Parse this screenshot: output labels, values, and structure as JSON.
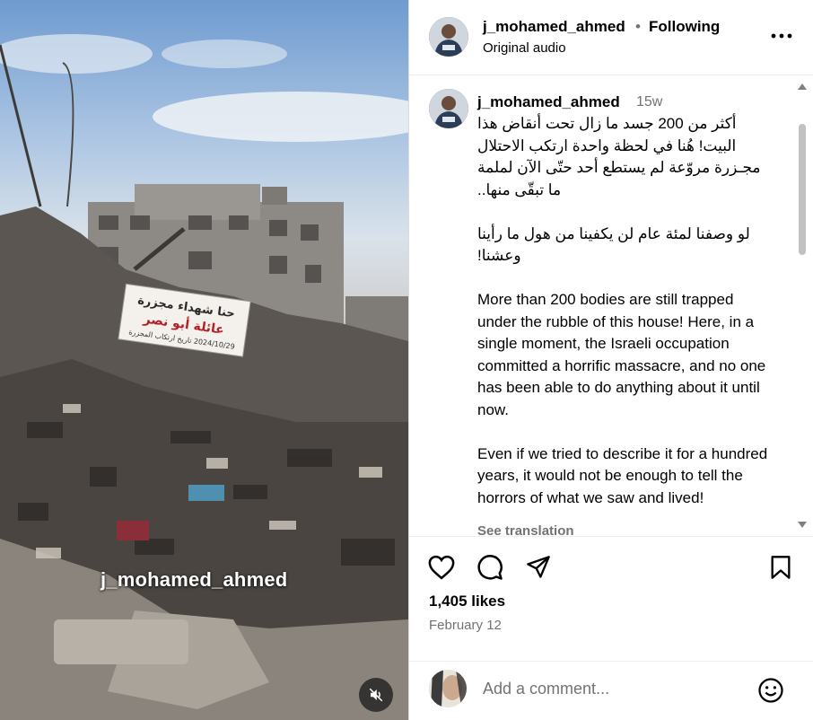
{
  "post": {
    "username": "j_mohamed_ahmed",
    "separator_dot": "•",
    "follow_status": "Following",
    "audio": "Original audio"
  },
  "media": {
    "watermark": "j_mohamed_ahmed",
    "banner_lines": [
      "حنا شهداء مجزرة",
      "عائلة أبو نصر",
      "2024/10/29 تاريخ ارتكاب المجزرة"
    ],
    "mute_icon": "speaker-muted-icon"
  },
  "caption": {
    "username": "j_mohamed_ahmed",
    "time_ago": "15w",
    "arabic_p1": "أكثر من 200 جسد ما زال تحت أنقاض هذا البيت! هُنا في لحظة واحدة ارتكب الاحتلال مجـزرة مروّعة لم يستطع أحد حتّى الآن لملمة ما تبقّى منها..",
    "arabic_p2": "لو وصفنا لمئة عام لن يكفينا من هول ما رأينا وعشنا!",
    "english_p1": "More than 200 bodies are still trapped under the rubble of this house! Here, in a single moment, the Israeli occupation committed a horrific massacre, and no one has been able to do anything about it until now.",
    "english_p2": "Even if we tried to describe it for a hundred years, it would not be enough to tell the horrors of what we saw and lived!",
    "see_translation": "See translation"
  },
  "actions": {
    "like_icon": "heart-icon",
    "comment_icon": "comment-icon",
    "share_icon": "send-icon",
    "save_icon": "bookmark-icon",
    "likes": "1,405 likes",
    "date": "February 12"
  },
  "comment_box": {
    "placeholder": "Add a comment...",
    "emoji_icon": "emoji-icon"
  },
  "colors": {
    "primary_text": "#000000",
    "secondary_text": "#737373",
    "divider": "#efefef",
    "scrollbar": "#c1c1c1"
  }
}
